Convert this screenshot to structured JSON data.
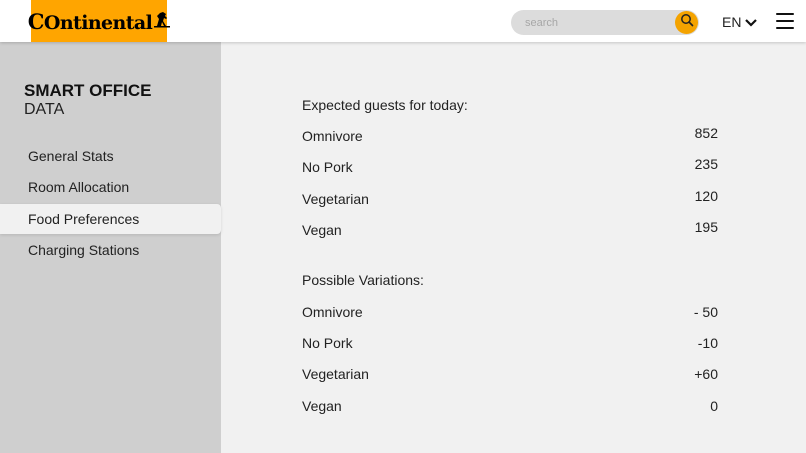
{
  "header": {
    "logo_text": "Ontinental",
    "search_placeholder": "search",
    "language": "EN"
  },
  "sidebar": {
    "title": "SMART OFFICE",
    "subtitle": "DATA",
    "items": [
      {
        "label": "General Stats"
      },
      {
        "label": "Room Allocation"
      },
      {
        "label": "Food Preferences",
        "active": true
      },
      {
        "label": "Charging Stations"
      }
    ]
  },
  "main": {
    "expected": {
      "title": "Expected guests for today:",
      "rows": [
        {
          "label": "Omnivore",
          "value": "852"
        },
        {
          "label": "No Pork",
          "value": "235"
        },
        {
          "label": "Vegetarian",
          "value": "120"
        },
        {
          "label": "Vegan",
          "value": "195"
        }
      ]
    },
    "variations": {
      "title": "Possible Variations:",
      "rows": [
        {
          "label": "Omnivore",
          "value": "- 50"
        },
        {
          "label": "No Pork",
          "value": "-10"
        },
        {
          "label": "Vegetarian",
          "value": "+60"
        },
        {
          "label": "Vegan",
          "value": "0"
        }
      ]
    }
  },
  "colors": {
    "brand": "#ffa500",
    "search_button": "#f4a300",
    "sidebar": "#cfcfcf",
    "content": "#f1f1f1"
  },
  "icons": [
    "continental-logo",
    "horse-icon",
    "search-icon",
    "chevron-down-icon",
    "hamburger-menu-icon"
  ]
}
